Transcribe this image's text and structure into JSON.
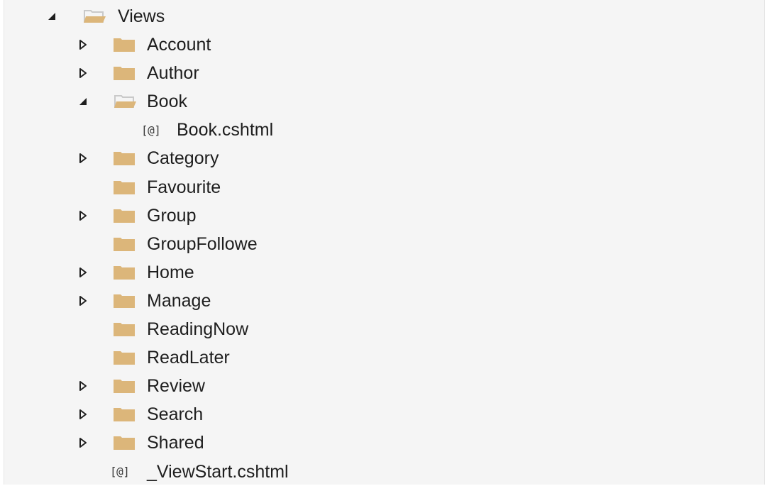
{
  "tree": {
    "root": {
      "label": "Views",
      "expanded": true
    },
    "items": [
      {
        "label": "Account",
        "type": "folder",
        "arrow": "collapsed"
      },
      {
        "label": "Author",
        "type": "folder",
        "arrow": "collapsed"
      },
      {
        "label": "Book",
        "type": "folder",
        "arrow": "expanded"
      },
      {
        "label": "Book.cshtml",
        "type": "file",
        "arrow": "none"
      },
      {
        "label": "Category",
        "type": "folder",
        "arrow": "collapsed"
      },
      {
        "label": "Favourite",
        "type": "folder",
        "arrow": "none"
      },
      {
        "label": "Group",
        "type": "folder",
        "arrow": "collapsed"
      },
      {
        "label": "GroupFollowe",
        "type": "folder",
        "arrow": "none"
      },
      {
        "label": "Home",
        "type": "folder",
        "arrow": "collapsed"
      },
      {
        "label": "Manage",
        "type": "folder",
        "arrow": "collapsed"
      },
      {
        "label": "ReadingNow",
        "type": "folder",
        "arrow": "none"
      },
      {
        "label": "ReadLater",
        "type": "folder",
        "arrow": "none"
      },
      {
        "label": "Review",
        "type": "folder",
        "arrow": "collapsed"
      },
      {
        "label": "Search",
        "type": "folder",
        "arrow": "collapsed"
      },
      {
        "label": "Shared",
        "type": "folder",
        "arrow": "collapsed"
      },
      {
        "label": "_ViewStart.cshtml",
        "type": "file",
        "arrow": "none"
      }
    ],
    "file_glyph": "[@]"
  },
  "colors": {
    "folder": "#dcb67a",
    "folder_open_back": "#c8c8c8",
    "text": "#1e1e1e",
    "background": "#f5f5f5"
  },
  "icons": {
    "folder_closed": "folder-icon",
    "folder_open": "open-folder-icon",
    "file": "razor-file-icon",
    "arrow_collapsed": "expand-arrow-icon",
    "arrow_expanded": "collapse-arrow-icon"
  }
}
